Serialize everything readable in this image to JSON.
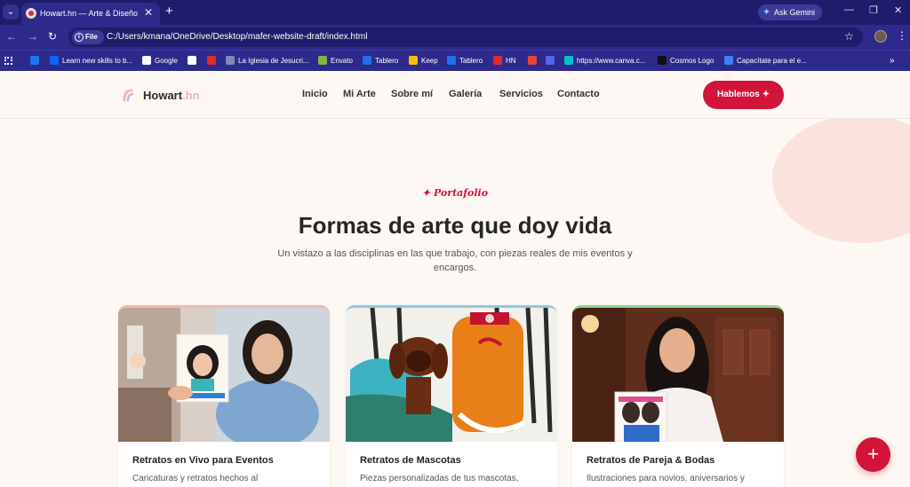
{
  "browser": {
    "tab_title": "Howart.hn — Arte & Diseño Cr",
    "address_chip": "File",
    "url": "C:/Users/kmana/OneDrive/Desktop/mafer-website-draft/index.html",
    "gemini_label": "Ask Gemini",
    "bookmarks": [
      {
        "label": "",
        "color": "#1877f2"
      },
      {
        "label": "Learn new skills to b...",
        "color": "#0866ff"
      },
      {
        "label": "Google",
        "color": "#ffffff"
      },
      {
        "label": "",
        "color": "#ffffff"
      },
      {
        "label": "",
        "color": "#e02b2b"
      },
      {
        "label": "La Iglesia de Jesucri...",
        "color": "#7c8ab8"
      },
      {
        "label": "Envato",
        "color": "#82b541"
      },
      {
        "label": "Tablero",
        "color": "#1a73e8"
      },
      {
        "label": "Keep",
        "color": "#fbbc04"
      },
      {
        "label": "Tablero",
        "color": "#1a73e8"
      },
      {
        "label": "HN",
        "color": "#e02b2b"
      },
      {
        "label": "",
        "color": "#ea4335"
      },
      {
        "label": "",
        "color": "#5865f2"
      },
      {
        "label": "https://www.canva.c...",
        "color": "#00c4cc"
      },
      {
        "label": "Cosmos Logo",
        "color": "#111111"
      },
      {
        "label": "Capacítate para el e...",
        "color": "#3b82f6"
      }
    ]
  },
  "site": {
    "logo_main": "Howart",
    "logo_suffix": ".hn",
    "nav": [
      "Inicio",
      "Mi Arte",
      "Sobre mí",
      "Galería",
      "Servicios",
      "Contacto"
    ],
    "cta_label": "Hablemos ✦",
    "eyebrow": "✦ Portafolio",
    "headline": "Formas de arte que doy vida",
    "lede": "Un vistazo a las disciplinas en las que trabajo, con piezas reales de mis eventos y encargos.",
    "cards": [
      {
        "title": "Retratos en Vivo para Eventos",
        "desc": "Caricaturas y retratos hechos al",
        "accent": "#f2b8b8"
      },
      {
        "title": "Retratos de Mascotas",
        "desc": "Piezas personalizadas de tus mascotas,",
        "accent": "#8ec8e8"
      },
      {
        "title": "Retratos de Pareja & Bodas",
        "desc": "Ilustraciones para novios, aniversarios y",
        "accent": "#8fd48f"
      }
    ],
    "fab_label": "+"
  },
  "colors": {
    "brand": "#d2143a",
    "chrome_dark": "#1f1d6b",
    "chrome": "#2d2a8c",
    "page_bg": "#fdf8f3"
  }
}
